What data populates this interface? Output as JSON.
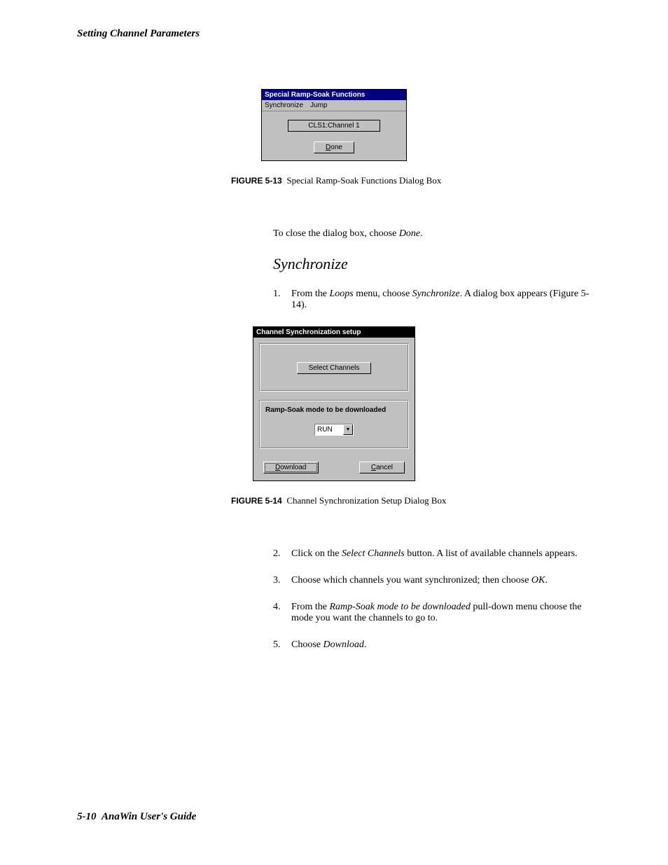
{
  "header": {
    "title": "Setting Channel Parameters"
  },
  "dialog1": {
    "title": "Special Ramp-Soak Functions",
    "menu": {
      "sync": "Synchronize",
      "jump": "Jump"
    },
    "channel": "CLS1:Channel 1",
    "done": "Done"
  },
  "fig1": {
    "label": "FIGURE 5-13",
    "caption": "Special Ramp-Soak Functions Dialog Box"
  },
  "para1": {
    "pre": "To close the dialog box, choose ",
    "done": "Done",
    "post": "."
  },
  "section": {
    "heading": "Synchronize"
  },
  "step1": {
    "num": "1.",
    "pre": "From the ",
    "loops": "Loops",
    "mid": " menu, choose ",
    "sync": "Synchronize",
    "post": ". A dialog box appears (Figure 5-14)."
  },
  "dialog2": {
    "title": "Channel Synchronization setup",
    "select_btn": "Select Channels",
    "group_label": "Ramp-Soak mode to be downloaded",
    "combo_value": "RUN",
    "download": "Download",
    "cancel": "Cancel"
  },
  "fig2": {
    "label": "FIGURE 5-14",
    "caption": "Channel Synchronization Setup Dialog Box"
  },
  "step2": {
    "num": "2.",
    "pre": "Click on the ",
    "sel": "Select Channels",
    "post": " button. A list of available channels appears."
  },
  "step3": {
    "num": "3.",
    "text": "Choose which channels you want synchronized; then choose ",
    "ok": "OK",
    "post": "."
  },
  "step4": {
    "num": "4.",
    "pre": "From the ",
    "rs": "Ramp-Soak mode to be downloaded",
    "post": " pull-down menu choose the mode you want the channels to go to."
  },
  "step5": {
    "num": "5.",
    "pre": "Choose ",
    "dl": "Download",
    "post": "."
  },
  "footer": {
    "page": "5-10",
    "guide": "AnaWin User's Guide"
  }
}
